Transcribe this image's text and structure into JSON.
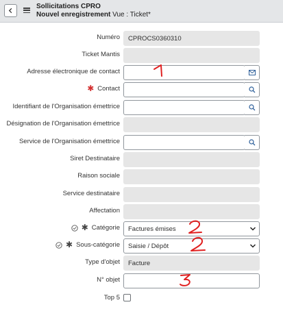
{
  "header": {
    "title": "Sollicitations CPRO",
    "subtitle_bold": "Nouvel enregistrement",
    "subtitle_view": "Vue : Ticket*"
  },
  "form": {
    "numero": {
      "label": "Numéro",
      "value": "CPROCS0360310"
    },
    "ticket_mantis": {
      "label": "Ticket Mantis",
      "value": ""
    },
    "adresse": {
      "label": "Adresse électronique de contact",
      "value": ""
    },
    "contact": {
      "label": "Contact",
      "value": ""
    },
    "identifiant_org": {
      "label": "Identifiant de l'Organisation émettrice",
      "value": ""
    },
    "designation_org": {
      "label": "Désignation de l'Organisation émettrice",
      "value": ""
    },
    "service_org": {
      "label": "Service de l'Organisation émettrice",
      "value": ""
    },
    "siret": {
      "label": "Siret Destinataire",
      "value": ""
    },
    "raison": {
      "label": "Raison sociale",
      "value": ""
    },
    "service_dest": {
      "label": "Service destinataire",
      "value": ""
    },
    "affectation": {
      "label": "Affectation",
      "value": ""
    },
    "categorie": {
      "label": "Catégorie",
      "value": "Factures émises"
    },
    "sous_categorie": {
      "label": "Sous-catégorie",
      "value": "Saisie / Dépôt"
    },
    "type_objet": {
      "label": "Type d'objet",
      "value": "Facture"
    },
    "n_objet": {
      "label": "N° objet",
      "value": ""
    },
    "top5": {
      "label": "Top 5",
      "checked": false
    }
  },
  "required_mark": "✱",
  "annotations": [
    "1",
    "2",
    "2",
    "3"
  ],
  "colors": {
    "required": "#d32f2f",
    "annotation": "#e02020",
    "readonly_bg": "#e6e6e6",
    "header_bg": "#e4e6e8"
  }
}
